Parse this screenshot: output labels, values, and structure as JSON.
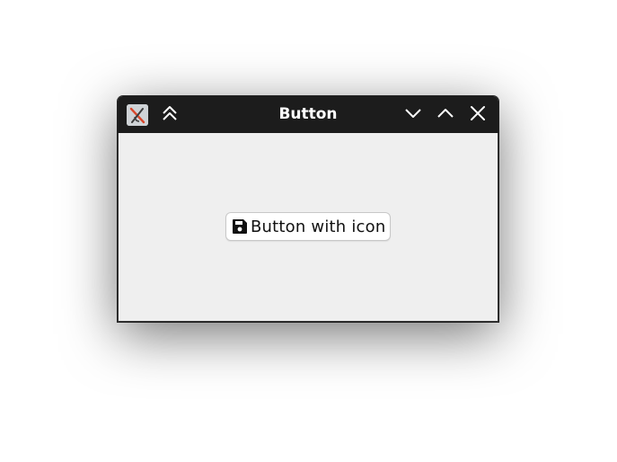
{
  "window": {
    "title": "Button",
    "titlebar_color": "#1c1c1c",
    "client_background": "#efefef"
  },
  "titlebar_icons": {
    "app": "app-logo-icon",
    "shade": "double-chevron-up-icon",
    "minimize": "chevron-down-icon",
    "maximize": "chevron-up-icon",
    "close": "close-icon"
  },
  "button": {
    "label": "Button with icon",
    "icon": "floppy-disk-icon"
  }
}
